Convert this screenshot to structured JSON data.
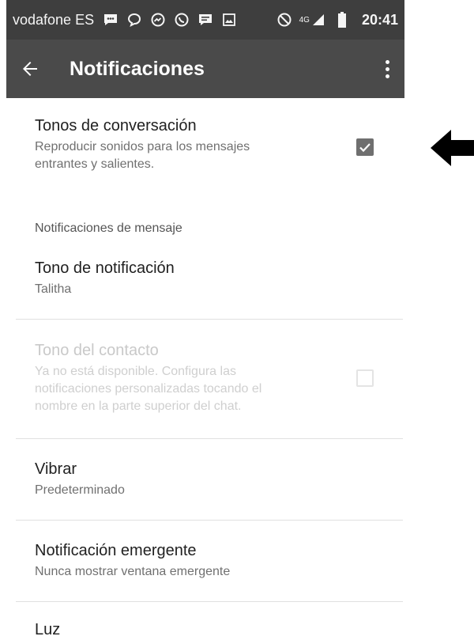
{
  "status_bar": {
    "carrier": "vodafone ES",
    "network": "4G",
    "time": "20:41",
    "icons": [
      "sms-icon",
      "chat-bubble-icon",
      "messenger-icon",
      "whatsapp-icon",
      "message-icon",
      "image-icon",
      "blocked-icon",
      "signal-icon",
      "battery-icon"
    ]
  },
  "app_bar": {
    "title": "Notificaciones",
    "back_icon": "arrow-back-icon",
    "menu_icon": "more-vert-icon"
  },
  "settings": {
    "conversation_tones": {
      "title": "Tonos de conversación",
      "subtitle_line1": "Reproducir sonidos para los mensajes",
      "subtitle_line2": "entrantes y salientes.",
      "checked": true
    },
    "section_header": "Notificaciones de mensaje",
    "notification_tone": {
      "title": "Tono de notificación",
      "value": "Talitha"
    },
    "contact_tone": {
      "title": "Tono del contacto",
      "line1": "Ya no está disponible. Configura las",
      "line2": "notificaciones personalizadas tocando el",
      "line3": "nombre en la parte superior del chat.",
      "checked": false,
      "enabled": false
    },
    "vibrate": {
      "title": "Vibrar",
      "value": "Predeterminado"
    },
    "popup": {
      "title": "Notificación emergente",
      "value": "Nunca mostrar ventana emergente"
    },
    "light": {
      "title": "Luz"
    }
  },
  "colors": {
    "status_bar": "#3e3e3e",
    "app_bar": "#4a4a4a",
    "checkbox_checked": "#6f6f6f",
    "disabled_text": "#c9c9c9"
  }
}
